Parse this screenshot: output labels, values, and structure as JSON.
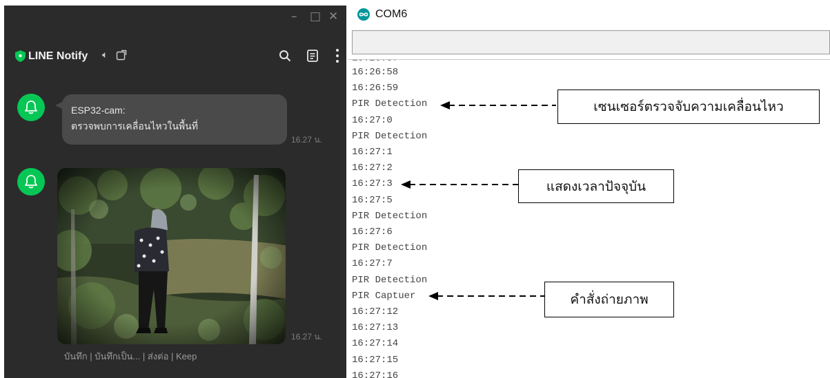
{
  "line_window": {
    "app_title": "LINE Notify",
    "window_controls": [
      "minimize-icon",
      "maximize-icon",
      "close-icon"
    ],
    "header_icons": [
      "shield-icon",
      "speaker-icon",
      "external-link-icon",
      "search-icon",
      "note-icon",
      "more-vertical-icon"
    ],
    "messages": [
      {
        "avatar_icon": "bell-icon",
        "sender": "ESP32-cam:",
        "text": "ตรวจพบการเคลื่อนไหวในพื้นที่",
        "time": "16.27 น."
      },
      {
        "avatar_icon": "bell-icon",
        "type": "photo",
        "time": "16.27 น.",
        "actions": [
          "บันทึก",
          "บันทึกเป็น...",
          "ส่งต่อ",
          "Keep"
        ]
      }
    ],
    "colors": {
      "background": "#2b2b2b",
      "brand_green": "#06c755",
      "bubble": "#4a4a4a"
    }
  },
  "serial_monitor": {
    "title": "COM6",
    "app_icon": "arduino-icon",
    "lines": [
      "16:26:58",
      "16:26:59",
      "PIR Detection",
      "16:27:0",
      "PIR Detection",
      "16:27:1",
      "16:27:2",
      "16:27:3",
      "16:27:5",
      "PIR Detection",
      "16:27:6",
      "PIR Detection",
      "16:27:7",
      "PIR Detection",
      "PIR Captuer",
      "16:27:12",
      "16:27:13",
      "16:27:14",
      "16:27:15",
      "16:27:16"
    ]
  },
  "annotations": [
    {
      "text": "เซนเซอร์ตรวจจับความเคลื่อนไหว",
      "points_to_line": "PIR Detection"
    },
    {
      "text": "แสดงเวลาปัจจุบัน",
      "points_to_line": "16:27:3"
    },
    {
      "text": "คำสั่งถ่ายภาพ",
      "points_to_line": "PIR Captuer"
    }
  ]
}
